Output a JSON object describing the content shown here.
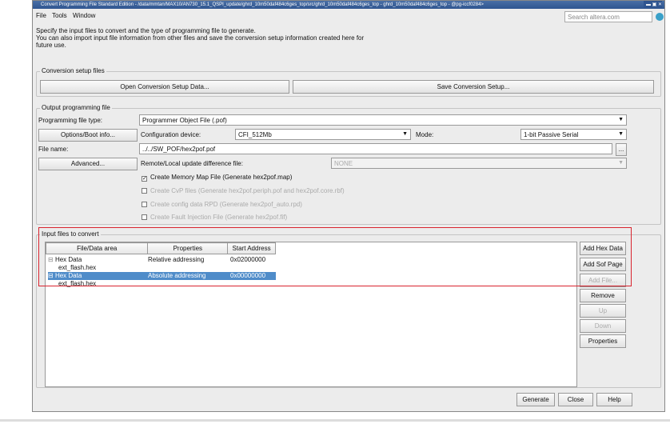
{
  "window": {
    "title": "Convert Programming File Standard Edition - /data/mmtan/MAX10/AN730_15.1_QSPI_update/ghrd_10m50daf484c6ges_top/src/ghrd_10m50daf484c6ges_top - ghrd_10m50daf484c6ges_top - @pg-iccf0284>",
    "controls": "▬ ▣ ✕"
  },
  "menu": [
    "File",
    "Tools",
    "Window"
  ],
  "search": {
    "placeholder": "Search altera.com"
  },
  "intro": [
    "Specify the input files to convert and the type of programming file to generate.",
    "You can also import input file information from other files and save the conversion setup information created here for future use."
  ],
  "conversion": {
    "label": "Conversion setup files",
    "open": "Open Conversion Setup Data...",
    "save": "Save Conversion Setup..."
  },
  "output": {
    "label": "Output programming file",
    "type_label": "Programming file type:",
    "type_value": "Programmer Object File (.pof)",
    "options_btn": "Options/Boot info...",
    "device_label": "Configuration device:",
    "device_value": "CFI_512Mb",
    "mode_label": "Mode:",
    "mode_value": "1-bit Passive Serial",
    "filename_label": "File name:",
    "filename_value": "../../SW_POF/hex2pof.pof",
    "browse": "...",
    "advanced_btn": "Advanced...",
    "remote_label": "Remote/Local update difference file:",
    "remote_value": "NONE",
    "checks": [
      {
        "label": "Create Memory Map File (Generate hex2pof.map)",
        "checked": true,
        "enabled": true
      },
      {
        "label": "Create CvP files (Generate hex2pof.periph.pof and hex2pof.core.rbf)",
        "checked": false,
        "enabled": false
      },
      {
        "label": "Create config data RPD (Generate hex2pof_auto.rpd)",
        "checked": false,
        "enabled": false
      },
      {
        "label": "Create Fault Injection File (Generate hex2pof.fif)",
        "checked": false,
        "enabled": false
      }
    ]
  },
  "input": {
    "label": "Input files to convert",
    "columns": [
      "File/Data area",
      "Properties",
      "Start Address"
    ],
    "rows": [
      {
        "name": "Hex Data",
        "props": "Relative addressing",
        "addr": "0x02000000",
        "child": "ext_flash.hex",
        "selected": false
      },
      {
        "name": "Hex Data",
        "props": "Absolute addressing",
        "addr": "0x00000000",
        "child": "ext_flash.hex",
        "selected": true
      }
    ],
    "buttons": [
      {
        "label": "Add Hex Data",
        "enabled": true
      },
      {
        "label": "Add Sof Page",
        "enabled": true
      },
      {
        "label": "Add File...",
        "enabled": false
      },
      {
        "label": "Remove",
        "enabled": true
      },
      {
        "label": "Up",
        "enabled": false
      },
      {
        "label": "Down",
        "enabled": false
      },
      {
        "label": "Properties",
        "enabled": true
      }
    ]
  },
  "footer": {
    "generate": "Generate",
    "close": "Close",
    "help": "Help"
  }
}
